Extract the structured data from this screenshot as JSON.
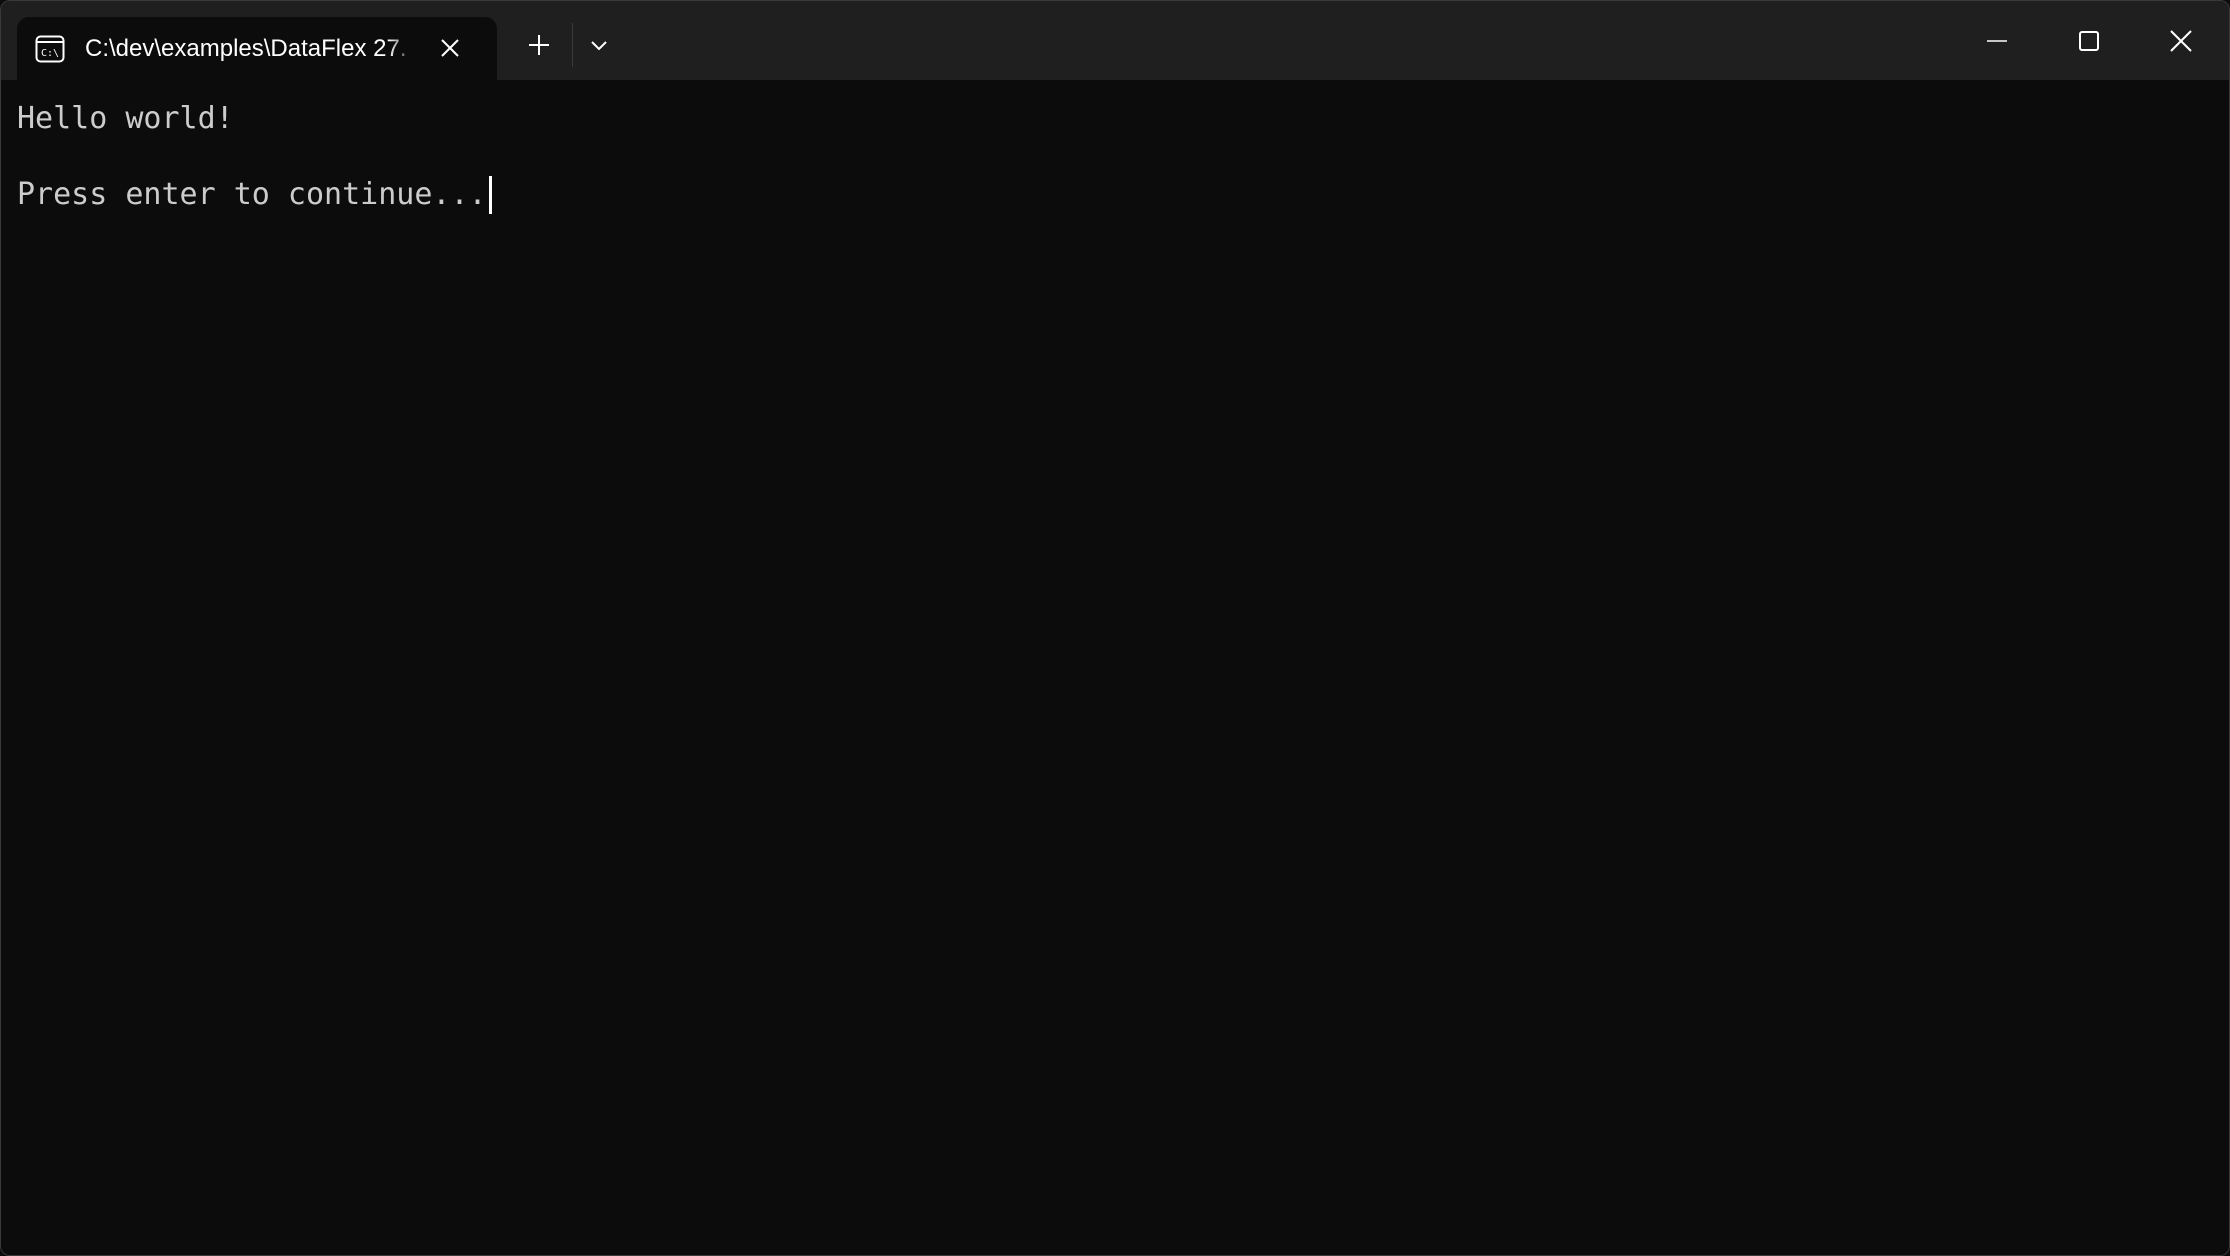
{
  "tab": {
    "title": "C:\\dev\\examples\\DataFlex 27.",
    "icon": "command-prompt-icon"
  },
  "titlebar": {
    "new_tab_icon": "plus-icon",
    "dropdown_icon": "chevron-down-icon",
    "minimize_icon": "minimize-icon",
    "maximize_icon": "maximize-icon",
    "close_icon": "close-icon"
  },
  "terminal": {
    "lines": [
      "Hello world!",
      "",
      "Press enter to continue..."
    ]
  },
  "colors": {
    "titlebar_bg": "#1f1f1f",
    "terminal_bg": "#0c0c0c",
    "text": "#cccccc"
  }
}
